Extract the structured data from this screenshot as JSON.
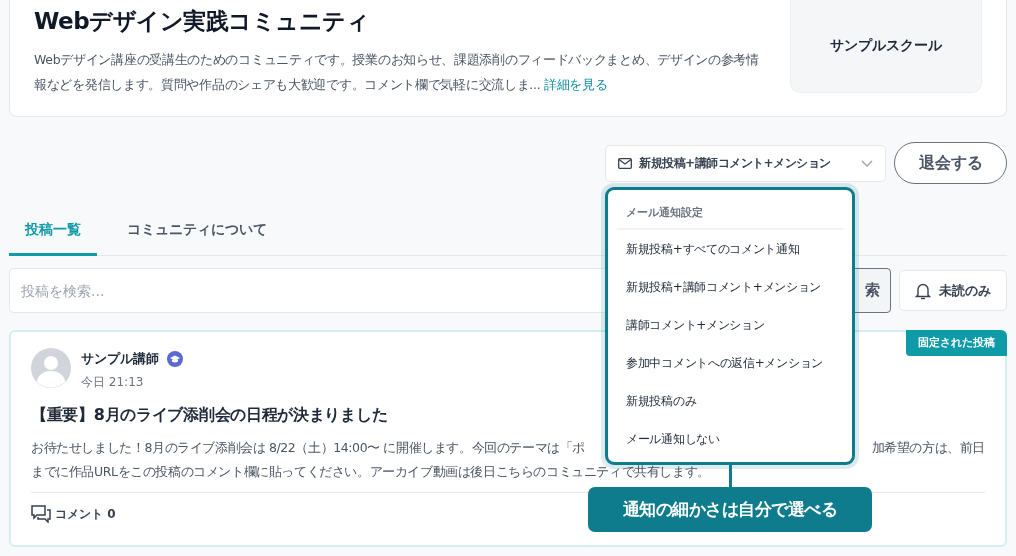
{
  "community": {
    "title": "Webデザイン実践コミュニティ",
    "description": "Webデザイン講座の受講生のためのコミュニティです。授業のお知らせ、課題添削のフィードバックまとめ、デザインの参考情報などを発信します。質問や作品のシェアも大歓迎です。コメント欄で気軽に交流しま...",
    "more_link": "詳細を見る",
    "school": "サンプルスクール"
  },
  "notification_select": {
    "value": "新規投稿+講師コメント+メンション"
  },
  "leave_button": "退会する",
  "tabs": [
    {
      "label": "投稿一覧",
      "selected": true
    },
    {
      "label": "コミュニティについて",
      "selected": false
    }
  ],
  "search": {
    "placeholder": "投稿を検索...",
    "button": "索"
  },
  "unread_button": "未読のみ",
  "post": {
    "author": "サンプル講師",
    "time": "今日 21:13",
    "pinned_badge": "固定された投稿",
    "title": "【重要】8月のライブ添削会の日程が決まりました",
    "body_line_1_left": "お待たせしました！8月のライブ添削会は 8/22（土）14:00〜 に開催します。今回のテーマは「ポ",
    "body_line_1_right": "加希望の方は、前日",
    "body_line_2": "までに作品URLをこの投稿のコメント欄に貼ってください。アーカイブ動画は後日こちらのコミュニティで共有します。",
    "comments": "コメント 0"
  },
  "dropdown": {
    "header": "メール通知設定",
    "options": [
      "新規投稿+すべてのコメント通知",
      "新規投稿+講師コメント+メンション",
      "講師コメント+メンション",
      "参加中コメントへの返信+メンション",
      "新規投稿のみ",
      "メール通知しない"
    ]
  },
  "callout": "通知の細かさは自分で選べる"
}
